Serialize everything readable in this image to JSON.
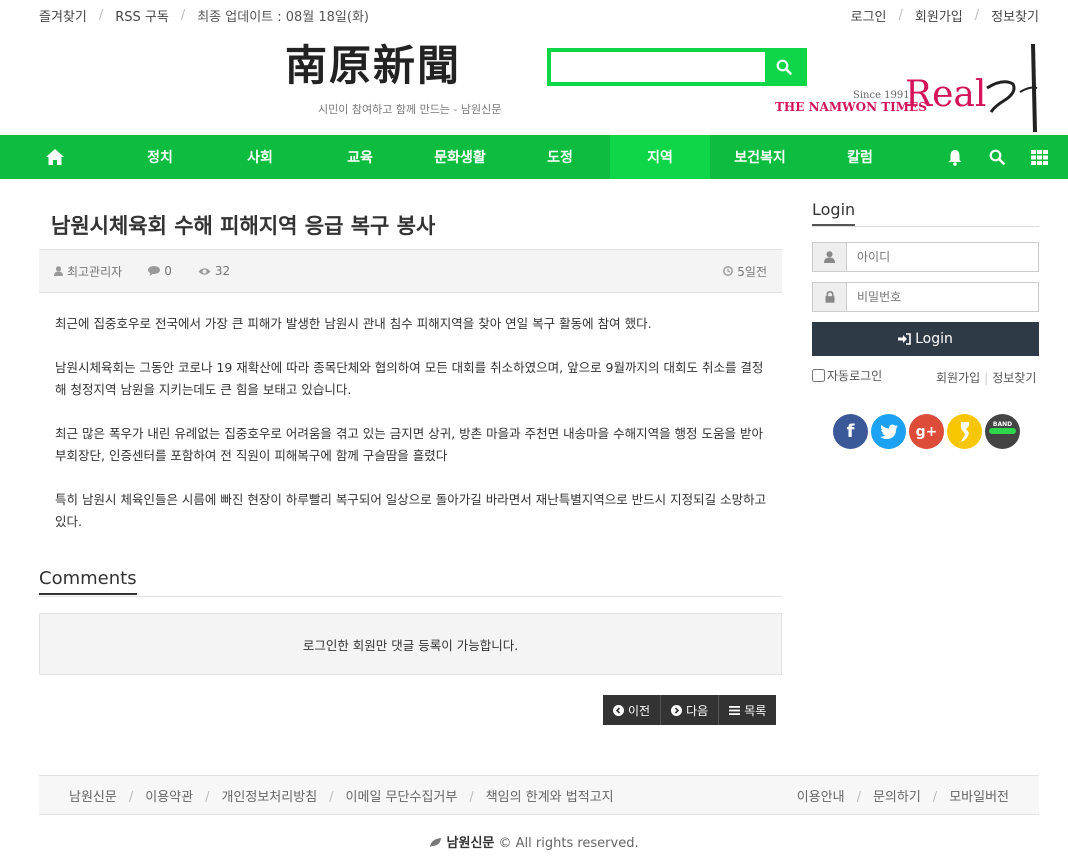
{
  "topbar": {
    "left": [
      "즐겨찾기",
      "RSS 구독",
      "최종 업데이트 : 08월 18일(화)"
    ],
    "right": [
      "로그인",
      "회원가입",
      "정보찾기"
    ]
  },
  "header": {
    "logo": "南原新聞",
    "tagline": "시민이 참여하고 함께 만드는 - 남원신문",
    "since": "Since 1991",
    "times": "THE NAMWON TIMES",
    "real": "Real",
    "accent": "#0fd649"
  },
  "nav": {
    "items": [
      "정치",
      "사회",
      "교육",
      "문화생활",
      "도정",
      "지역",
      "보건복지",
      "칼럼"
    ],
    "active": "지역"
  },
  "article": {
    "title": "남원시체육회 수해 피해지역 응급 복구 봉사",
    "author": "최고관리자",
    "comments": "0",
    "views": "32",
    "date": "5일전",
    "paragraphs": [
      "최근에 집중호우로 전국에서 가장 큰 피해가 발생한 남원시 관내 침수 피해지역을 찾아 연일 복구 활동에 참여 했다.",
      "남원시체육회는 그동안 코로나 19 재확산에 따라 종목단체와 협의하여 모든 대회를 취소하였으며, 앞으로 9월까지의 대회도 취소를 결정해 청정지역 남원을 지키는데도 큰 힘을 보태고 있습니다.",
      "최근 많은 폭우가 내린 유례없는 집중호우로 어려움을 겪고 있는 금지면 상귀, 방촌 마을과 주천면 내송마을 수해지역을 행정 도움을 받아 부회장단, 인증센터를 포함하여 전 직원이 피해복구에 함께 구슬땀을 흘렸다",
      "특히 남원시 체육인들은 시름에 빠진 현장이 하루빨리 복구되어 일상으로 돌아가길 바라면서 재난특별지역으로 반드시 지정되길 소망하고 있다."
    ]
  },
  "comments": {
    "heading": "Comments",
    "notice": "로그인한 회원만 댓글 등록이 가능합니다."
  },
  "pager": {
    "prev": "이전",
    "next": "다음",
    "list": "목록"
  },
  "login": {
    "heading": "Login",
    "id_placeholder": "아이디",
    "pw_placeholder": "비밀번호",
    "button": "Login",
    "auto": "자동로그인",
    "join": "회원가입",
    "find": "정보찾기"
  },
  "social": [
    {
      "icon": "facebook-icon",
      "color": "#3b5998",
      "glyph": "f"
    },
    {
      "icon": "twitter-icon",
      "color": "#1da1f2",
      "glyph": "t"
    },
    {
      "icon": "googleplus-icon",
      "color": "#dd4b39",
      "glyph": "g+"
    },
    {
      "icon": "kakaostory-icon",
      "color": "#f7c600",
      "glyph": "s"
    },
    {
      "icon": "band-icon",
      "color": "#444444",
      "glyph": "BAND"
    }
  ],
  "footer": {
    "left": [
      "남원신문",
      "이용약관",
      "개인정보처리방침",
      "이메일 무단수집거부",
      "책임의 한계와 법적고지"
    ],
    "right": [
      "이용안내",
      "문의하기",
      "모바일버전"
    ],
    "brand": "남원신문",
    "copyright": "© All rights reserved."
  }
}
